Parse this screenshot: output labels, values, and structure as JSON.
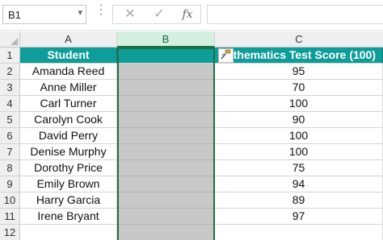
{
  "formula_bar": {
    "name_box": "B1",
    "name_box_caret": "▾",
    "more_glyph": "⋮",
    "cancel_glyph": "✕",
    "enter_glyph": "✓",
    "fx_label": "fx",
    "formula_value": ""
  },
  "columns": [
    "A",
    "B",
    "C"
  ],
  "rows": [
    "1",
    "2",
    "3",
    "4",
    "5",
    "6",
    "7",
    "8",
    "9",
    "10",
    "11",
    "12"
  ],
  "header": {
    "student": "Student",
    "blank": "",
    "score": "athematics Test Score (100)"
  },
  "students": [
    "Amanda Reed",
    "Anne Miller",
    "Carl Turner",
    "Carolyn Cook",
    "David Perry",
    "Denise Murphy",
    "Dorothy Price",
    "Emily Brown",
    "Harry Garcia",
    "Irene Bryant"
  ],
  "scores": [
    "95",
    "70",
    "100",
    "90",
    "100",
    "100",
    "75",
    "94",
    "89",
    "97"
  ],
  "colors": {
    "header_fill": "#0f9d99",
    "grey_fill": "#c8c8c8",
    "selection": "#1e7145"
  },
  "cursor_icon": "paintbrush-icon"
}
